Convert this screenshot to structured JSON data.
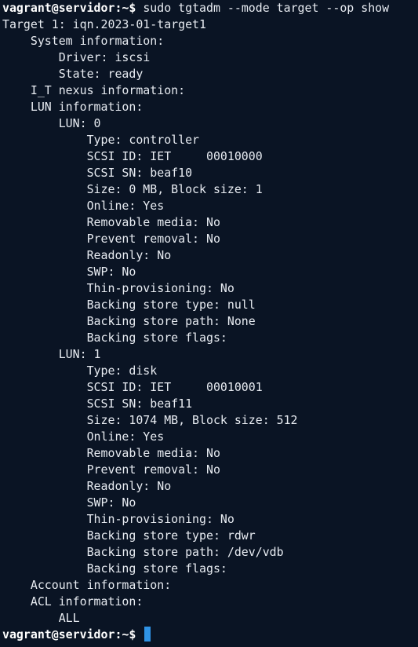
{
  "prompt": {
    "user_host": "vagrant@servidor",
    "sep": ":~$"
  },
  "command": "sudo tgtadm --mode target --op show",
  "output": [
    "Target 1: iqn.2023-01-target1",
    "    System information:",
    "        Driver: iscsi",
    "        State: ready",
    "    I_T nexus information:",
    "    LUN information:",
    "        LUN: 0",
    "            Type: controller",
    "            SCSI ID: IET     00010000",
    "            SCSI SN: beaf10",
    "            Size: 0 MB, Block size: 1",
    "            Online: Yes",
    "            Removable media: No",
    "            Prevent removal: No",
    "            Readonly: No",
    "            SWP: No",
    "            Thin-provisioning: No",
    "            Backing store type: null",
    "            Backing store path: None",
    "            Backing store flags:",
    "        LUN: 1",
    "            Type: disk",
    "            SCSI ID: IET     00010001",
    "            SCSI SN: beaf11",
    "            Size: 1074 MB, Block size: 512",
    "            Online: Yes",
    "            Removable media: No",
    "            Prevent removal: No",
    "            Readonly: No",
    "            SWP: No",
    "            Thin-provisioning: No",
    "            Backing store type: rdwr",
    "            Backing store path: /dev/vdb",
    "            Backing store flags:",
    "    Account information:",
    "    ACL information:",
    "        ALL"
  ],
  "colors": {
    "background": "#0a1424",
    "text": "#e8ecf2",
    "cursor": "#2f93e6"
  }
}
